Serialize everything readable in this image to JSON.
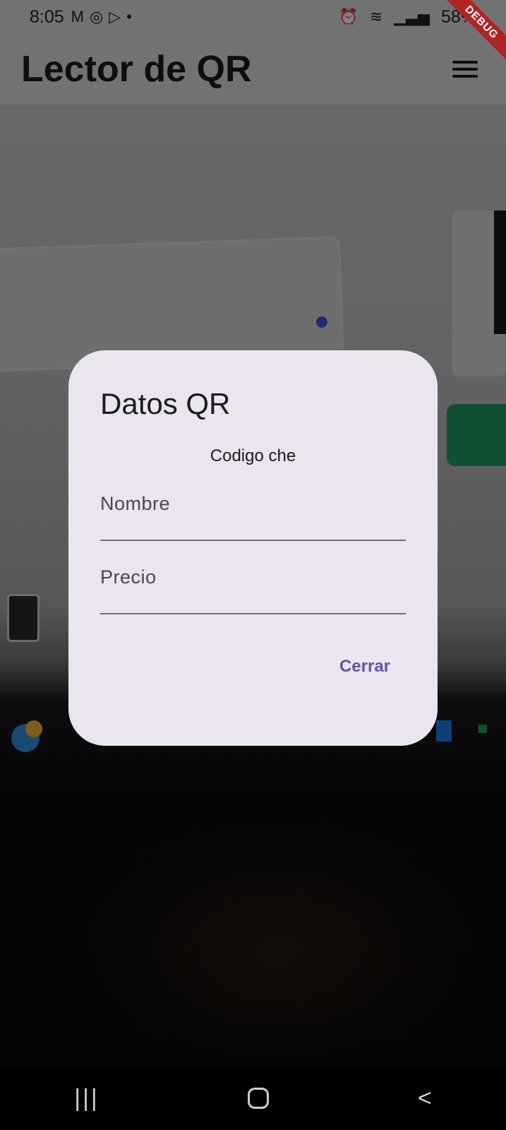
{
  "status_bar": {
    "time": "8:05",
    "left_icons": [
      "gmail-icon",
      "whatsapp-icon",
      "play-icon",
      "dot-icon"
    ],
    "battery": "58%",
    "right_icons": [
      "alarm-icon",
      "wifi-icon",
      "signal-icon"
    ]
  },
  "app_bar": {
    "title": "Lector de QR",
    "menu_icon": "list-icon"
  },
  "debug_banner": "DEBUG",
  "dialog": {
    "title": "Datos QR",
    "code": "Codigo che",
    "fields": [
      {
        "label": "Nombre",
        "value": ""
      },
      {
        "label": "Precio",
        "value": ""
      }
    ],
    "close_label": "Cerrar"
  },
  "colors": {
    "dialog_bg": "#ebe5ef",
    "accent": "#6b4fa6",
    "app_bar": "#dcdadd",
    "debug": "#b22323"
  },
  "nav_bar": {
    "icons": [
      "recent-apps-icon",
      "home-icon",
      "back-icon"
    ]
  }
}
